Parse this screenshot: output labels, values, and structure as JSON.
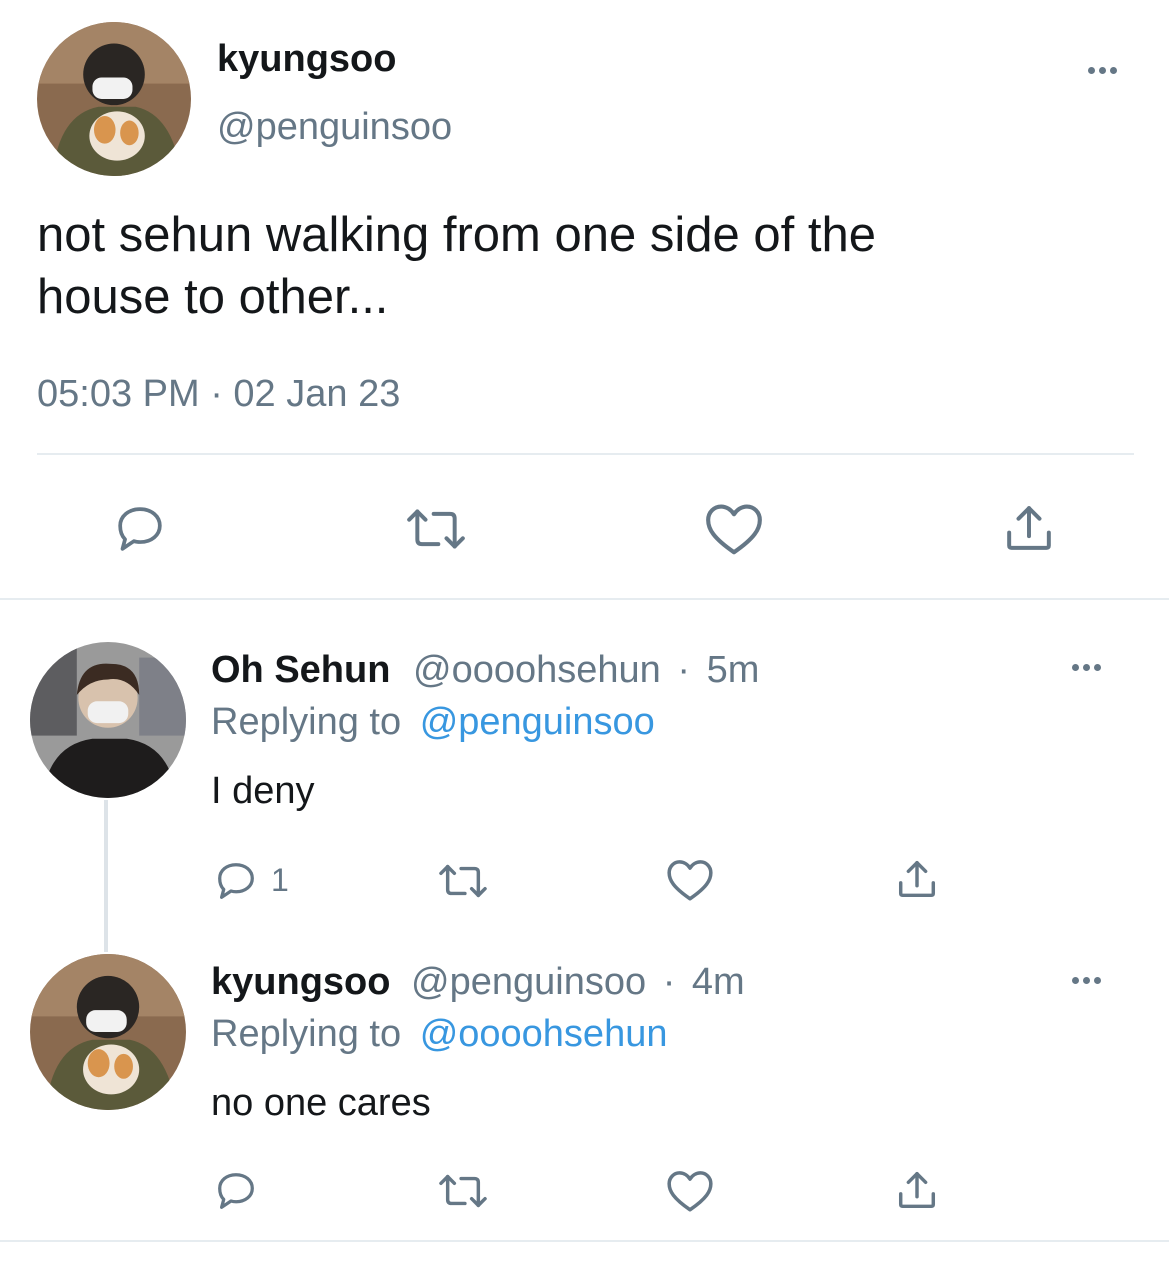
{
  "main_tweet": {
    "display_name": "kyungsoo",
    "handle": "@penguinsoo",
    "text_line1": "not sehun walking from one side of the",
    "text_line2": "house to other...",
    "timestamp": "05:03 PM · 02 Jan 23",
    "avatar_icon": "user-photo-with-puppy"
  },
  "replies": [
    {
      "display_name": "Oh Sehun",
      "handle": "@oooohsehun",
      "separator": "·",
      "time": "5m",
      "replying_prefix": "Replying to",
      "replying_to": "@penguinsoo",
      "text": "I deny",
      "reply_count": "1",
      "avatar_icon": "user-photo-masked"
    },
    {
      "display_name": "kyungsoo",
      "handle": "@penguinsoo",
      "separator": "·",
      "time": "4m",
      "replying_prefix": "Replying to",
      "replying_to": "@oooohsehun",
      "text": "no one cares",
      "reply_count": "",
      "avatar_icon": "user-photo-with-puppy"
    }
  ],
  "icons": {
    "reply": "reply-icon",
    "retweet": "retweet-icon",
    "like": "heart-icon",
    "share": "share-icon",
    "more": "more-options-icon"
  },
  "colors": {
    "text": "#14171a",
    "muted": "#657786",
    "link": "#3897e0",
    "divider": "#e6ecf0"
  }
}
